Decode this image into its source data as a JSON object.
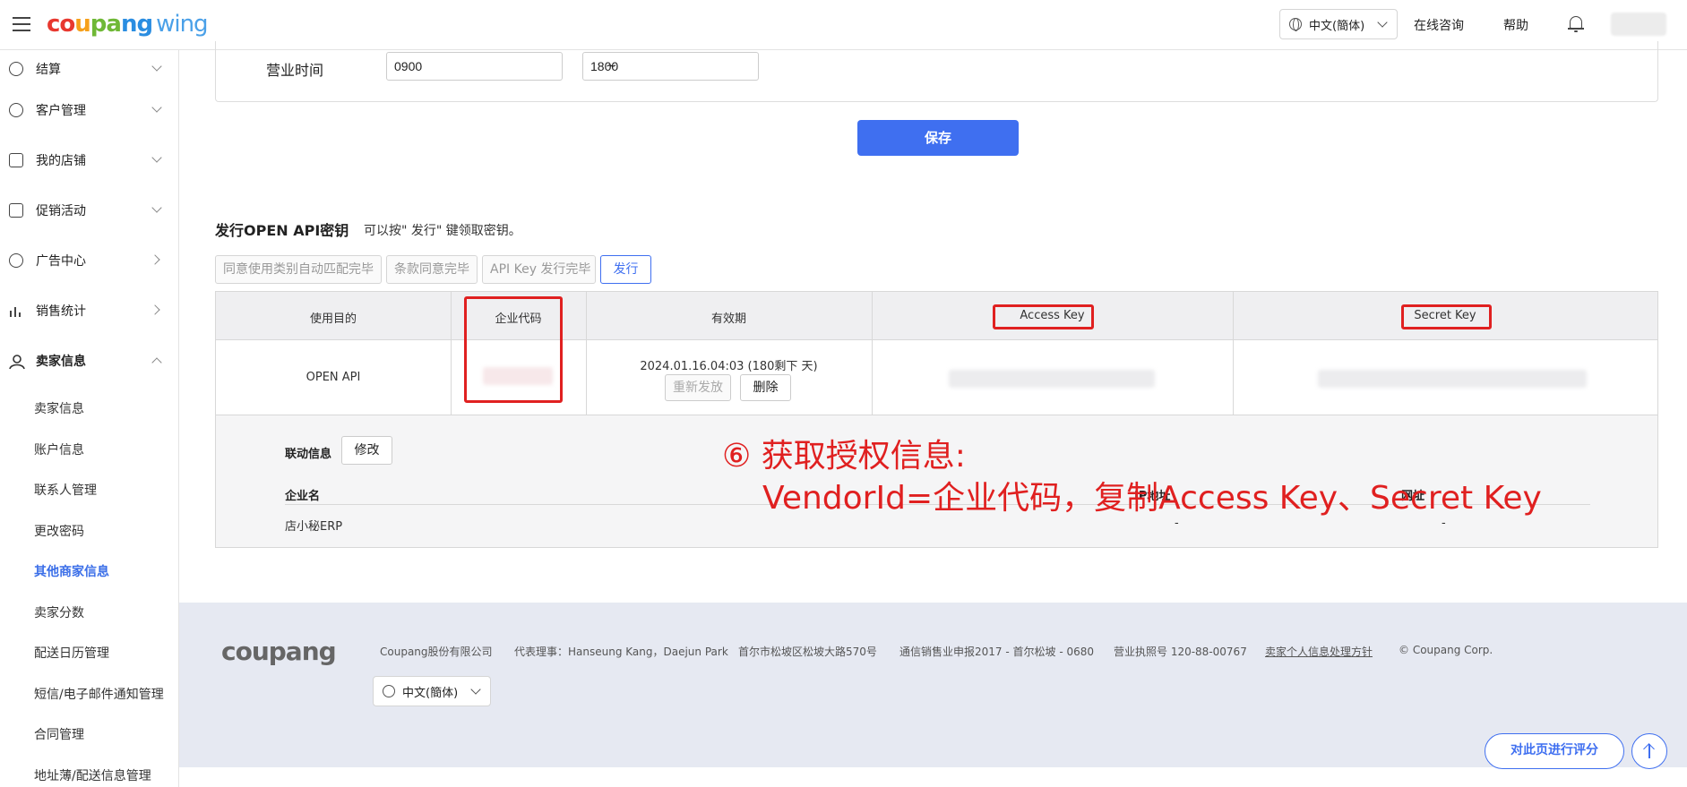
{
  "header": {
    "logo": {
      "c1": "co",
      "c2": "u",
      "c3": "pa",
      "c4": "ng",
      "wing": "wing"
    },
    "language": "中文(簡体)",
    "online_consult": "在线咨询",
    "help": "帮助"
  },
  "sidebar": {
    "items": [
      {
        "label": "结算",
        "icon": "won-icon"
      },
      {
        "label": "客户管理",
        "icon": "smile-icon"
      },
      {
        "label": "我的店铺",
        "icon": "store-icon"
      },
      {
        "label": "促销活动",
        "icon": "ticket-icon"
      },
      {
        "label": "广告中心",
        "icon": "pie-icon"
      },
      {
        "label": "销售统计",
        "icon": "bar-chart-icon"
      },
      {
        "label": "卖家信息",
        "icon": "user-icon"
      }
    ],
    "sub_items": [
      "卖家信息",
      "账户信息",
      "联系人管理",
      "更改密码",
      "其他商家信息",
      "卖家分数",
      "配送日历管理",
      "短信/电子邮件通知管理",
      "合同管理",
      "地址薄/配送信息管理"
    ]
  },
  "business_hours": {
    "label": "营业时间",
    "from": "0900",
    "separator": "~",
    "to": "1800"
  },
  "save_label": "保存",
  "api": {
    "title": "发行OPEN API密钥",
    "hint": "可以按\" 发行\" 键领取密钥。",
    "steps": [
      "同意使用类别自动匹配完毕",
      "条款同意完毕",
      "API Key 发行完毕",
      "发行"
    ],
    "columns": [
      "使用目的",
      "企业代码",
      "有效期",
      "Access Key",
      "Secret Key"
    ],
    "row": {
      "purpose": "OPEN API",
      "validity": "2024.01.16.04:03 (180剩下 天)",
      "reissue": "重新发放",
      "delete": "删除"
    },
    "link_info": {
      "label": "联动信息",
      "modify": "修改",
      "col_company": "企业名",
      "col_ip": "IP地址",
      "col_url": "网址",
      "company": "店小秘ERP",
      "ip": "-",
      "url": "-"
    }
  },
  "annotation": {
    "line1": "⑥ 获取授权信息:",
    "line2": "VendorId=企业代码，复制Access Key、Secret Key"
  },
  "footer": {
    "logo": "coupang",
    "company": "Coupang股份有限公司",
    "ceo": "代表理事：Hanseung Kang，Daejun Park",
    "address": "首尔市松坡区松坡大路570号",
    "telecom": "通信销售业申报2017 - 首尔松坡 - 0680",
    "license": "营业执照号 120-88-00767",
    "privacy": "卖家个人信息处理方针",
    "copyright": "© Coupang Corp.",
    "language": "中文(簡体)",
    "rate": "对此页进行评分"
  },
  "colors": {
    "primary": "#3f6ff0",
    "annotation": "#e02020",
    "footer_bg": "#e6e9f2"
  }
}
